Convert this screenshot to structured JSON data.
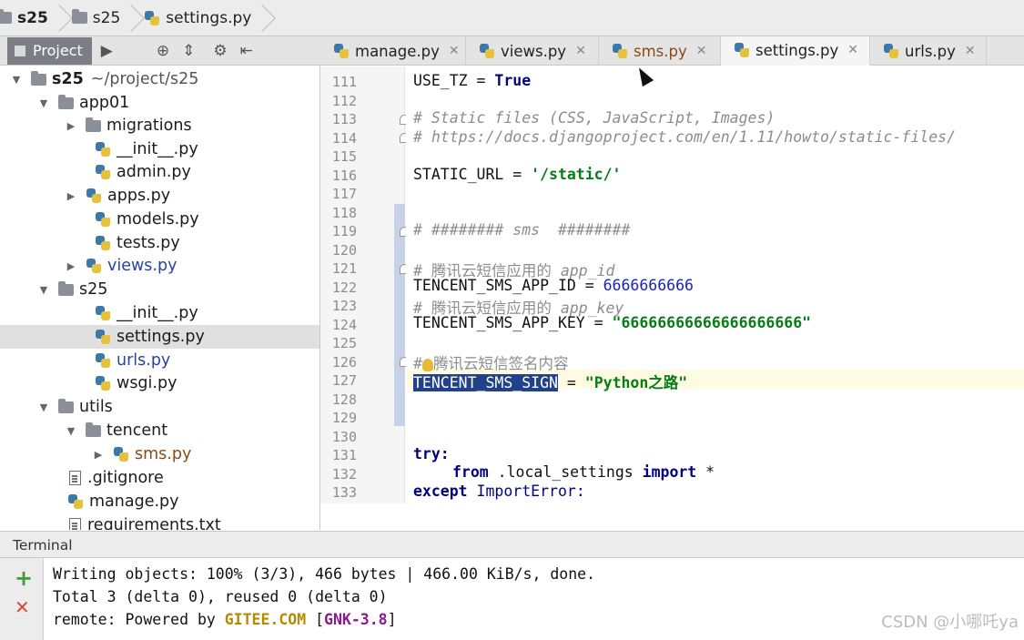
{
  "breadcrumb": [
    "s25",
    "s25",
    "settings.py"
  ],
  "project_panel": {
    "tab_label": "Project"
  },
  "tree": {
    "root_name": "s25",
    "root_path": "~/project/s25",
    "items": [
      {
        "label": "app01",
        "type": "folder"
      },
      {
        "label": "migrations",
        "type": "folder"
      },
      {
        "label": "__init__.py",
        "type": "py"
      },
      {
        "label": "admin.py",
        "type": "py"
      },
      {
        "label": "apps.py",
        "type": "py"
      },
      {
        "label": "models.py",
        "type": "py"
      },
      {
        "label": "tests.py",
        "type": "py"
      },
      {
        "label": "views.py",
        "type": "py"
      },
      {
        "label": "s25",
        "type": "folder"
      },
      {
        "label": "__init__.py",
        "type": "py"
      },
      {
        "label": "settings.py",
        "type": "py"
      },
      {
        "label": "urls.py",
        "type": "py"
      },
      {
        "label": "wsgi.py",
        "type": "py"
      },
      {
        "label": "utils",
        "type": "folder"
      },
      {
        "label": "tencent",
        "type": "folder"
      },
      {
        "label": "sms.py",
        "type": "py"
      },
      {
        "label": ".gitignore",
        "type": "file"
      },
      {
        "label": "manage.py",
        "type": "py"
      },
      {
        "label": "requirements.txt",
        "type": "file"
      }
    ]
  },
  "editor_tabs": [
    "manage.py",
    "views.py",
    "sms.py",
    "settings.py",
    "urls.py"
  ],
  "active_tab": "settings.py",
  "line_numbers": [
    "111",
    "112",
    "113",
    "114",
    "115",
    "116",
    "117",
    "118",
    "119",
    "120",
    "121",
    "122",
    "123",
    "124",
    "125",
    "126",
    "127",
    "128",
    "129",
    "130",
    "131",
    "132",
    "133"
  ],
  "code": {
    "l111_name": "USE_TZ",
    "l111_eq": " = ",
    "l111_val": "True",
    "l113": "# Static files (CSS, JavaScript, Images)",
    "l114": "# https://docs.djangoproject.com/en/1.11/howto/static-files/",
    "l116_name": "STATIC_URL = ",
    "l116_val": "'/static/'",
    "l119": "# ######## sms  ########",
    "l121_a": "# 腾讯云短信应用的 ",
    "l121_b": "app_id",
    "l122_name": "TENCENT_SMS_APP_ID = ",
    "l122_val": "6666666666",
    "l123_a": "# 腾讯云短信应用的 ",
    "l123_b": "app_key",
    "l124_name": "TENCENT_SMS_APP_KEY = ",
    "l124_val": "\"66666666666666666666\"",
    "l126_a": "#",
    "l126_b": "腾讯云短信签名内容",
    "l127_name": "TENCENT_SMS_SIGN",
    "l127_eq": " = ",
    "l127_val": "\"Python之路\"",
    "l131": "try:",
    "l132_kw1": "from",
    "l132_mid": " .local_settings ",
    "l132_kw2": "import",
    "l132_end": " *",
    "l133_kw": "except",
    "l133_name": " ImportError:"
  },
  "terminal": {
    "title": "Terminal",
    "line1": "Writing objects: 100% (3/3), 466 bytes | 466.00 KiB/s, done.",
    "line2": "Total 3 (delta 0), reused 0 (delta 0)",
    "line3_a": "remote: Powered by ",
    "line3_b": "GITEE.COM",
    "line3_c": " [",
    "line3_d": "GNK-3.8",
    "line3_e": "]",
    "add_icon": "+",
    "close_icon": "✕"
  },
  "watermark": "CSDN @小哪吒ya"
}
